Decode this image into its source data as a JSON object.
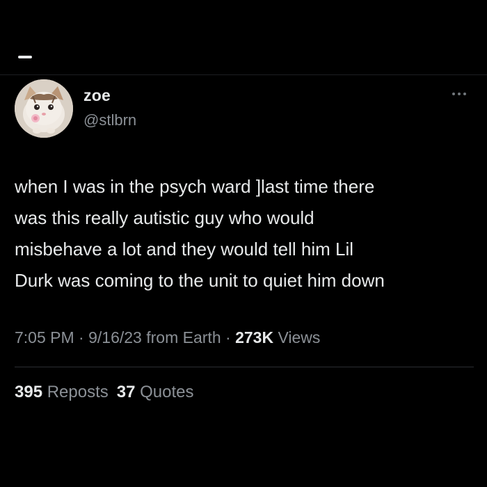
{
  "tweet": {
    "author": {
      "display_name": "zoe",
      "handle": "@stlbrn",
      "avatar_icon": "kitten-avatar"
    },
    "text_lines": [
      "when I was in the psych ward ]last time there",
      "was this really autistic guy who would",
      "misbehave a lot and they would tell him Lil",
      "Durk was coming to the unit to quiet him down"
    ],
    "meta": {
      "time": "7:05 PM",
      "sep1": " · ",
      "date": "9/16/23",
      "source": " from Earth",
      "sep2": " · ",
      "views_count": "273K",
      "views_label": " Views"
    },
    "stats": {
      "reposts_count": "395",
      "reposts_label": " Reposts",
      "quotes_count": "37",
      "quotes_label": " Quotes"
    }
  },
  "icons": {
    "more": "more-dots-icon",
    "back": "back-dash-icon"
  },
  "colors": {
    "background": "#000000",
    "primary_text": "#e7e9ea",
    "secondary_text": "#8b9096",
    "divider": "#2b2e32"
  }
}
